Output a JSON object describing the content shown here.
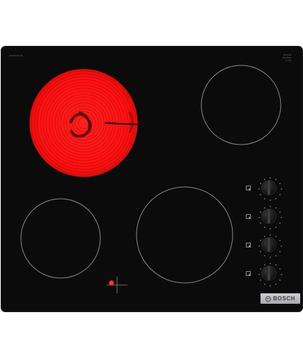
{
  "product": {
    "model_text": "PKE611K17E",
    "spec_text_line1": "BOSCH",
    "spec_text_line2": "220-240V",
    "spec_text_line3": "5,7 kW",
    "brand": "BOSCH"
  },
  "colors": {
    "glass": "#0b0b0c",
    "zone_outline": "#8a8a8a",
    "hot_zone": "#ff1a1a",
    "indicator_light": "#ff3a1a",
    "brand_plate": "#c2c2c5"
  },
  "zones": [
    {
      "name": "rear-left",
      "state": "heating"
    },
    {
      "name": "rear-right",
      "state": "off"
    },
    {
      "name": "front-left",
      "state": "off"
    },
    {
      "name": "front-center",
      "state": "off"
    }
  ],
  "knobs": [
    {
      "name": "knob-1",
      "symbol": "zone-symbol"
    },
    {
      "name": "knob-2",
      "symbol": "zone-symbol"
    },
    {
      "name": "knob-3",
      "symbol": "zone-symbol"
    },
    {
      "name": "knob-4",
      "symbol": "zone-symbol"
    }
  ],
  "indicator": {
    "icon": "residual-heat-indicator-icon",
    "on": true
  }
}
